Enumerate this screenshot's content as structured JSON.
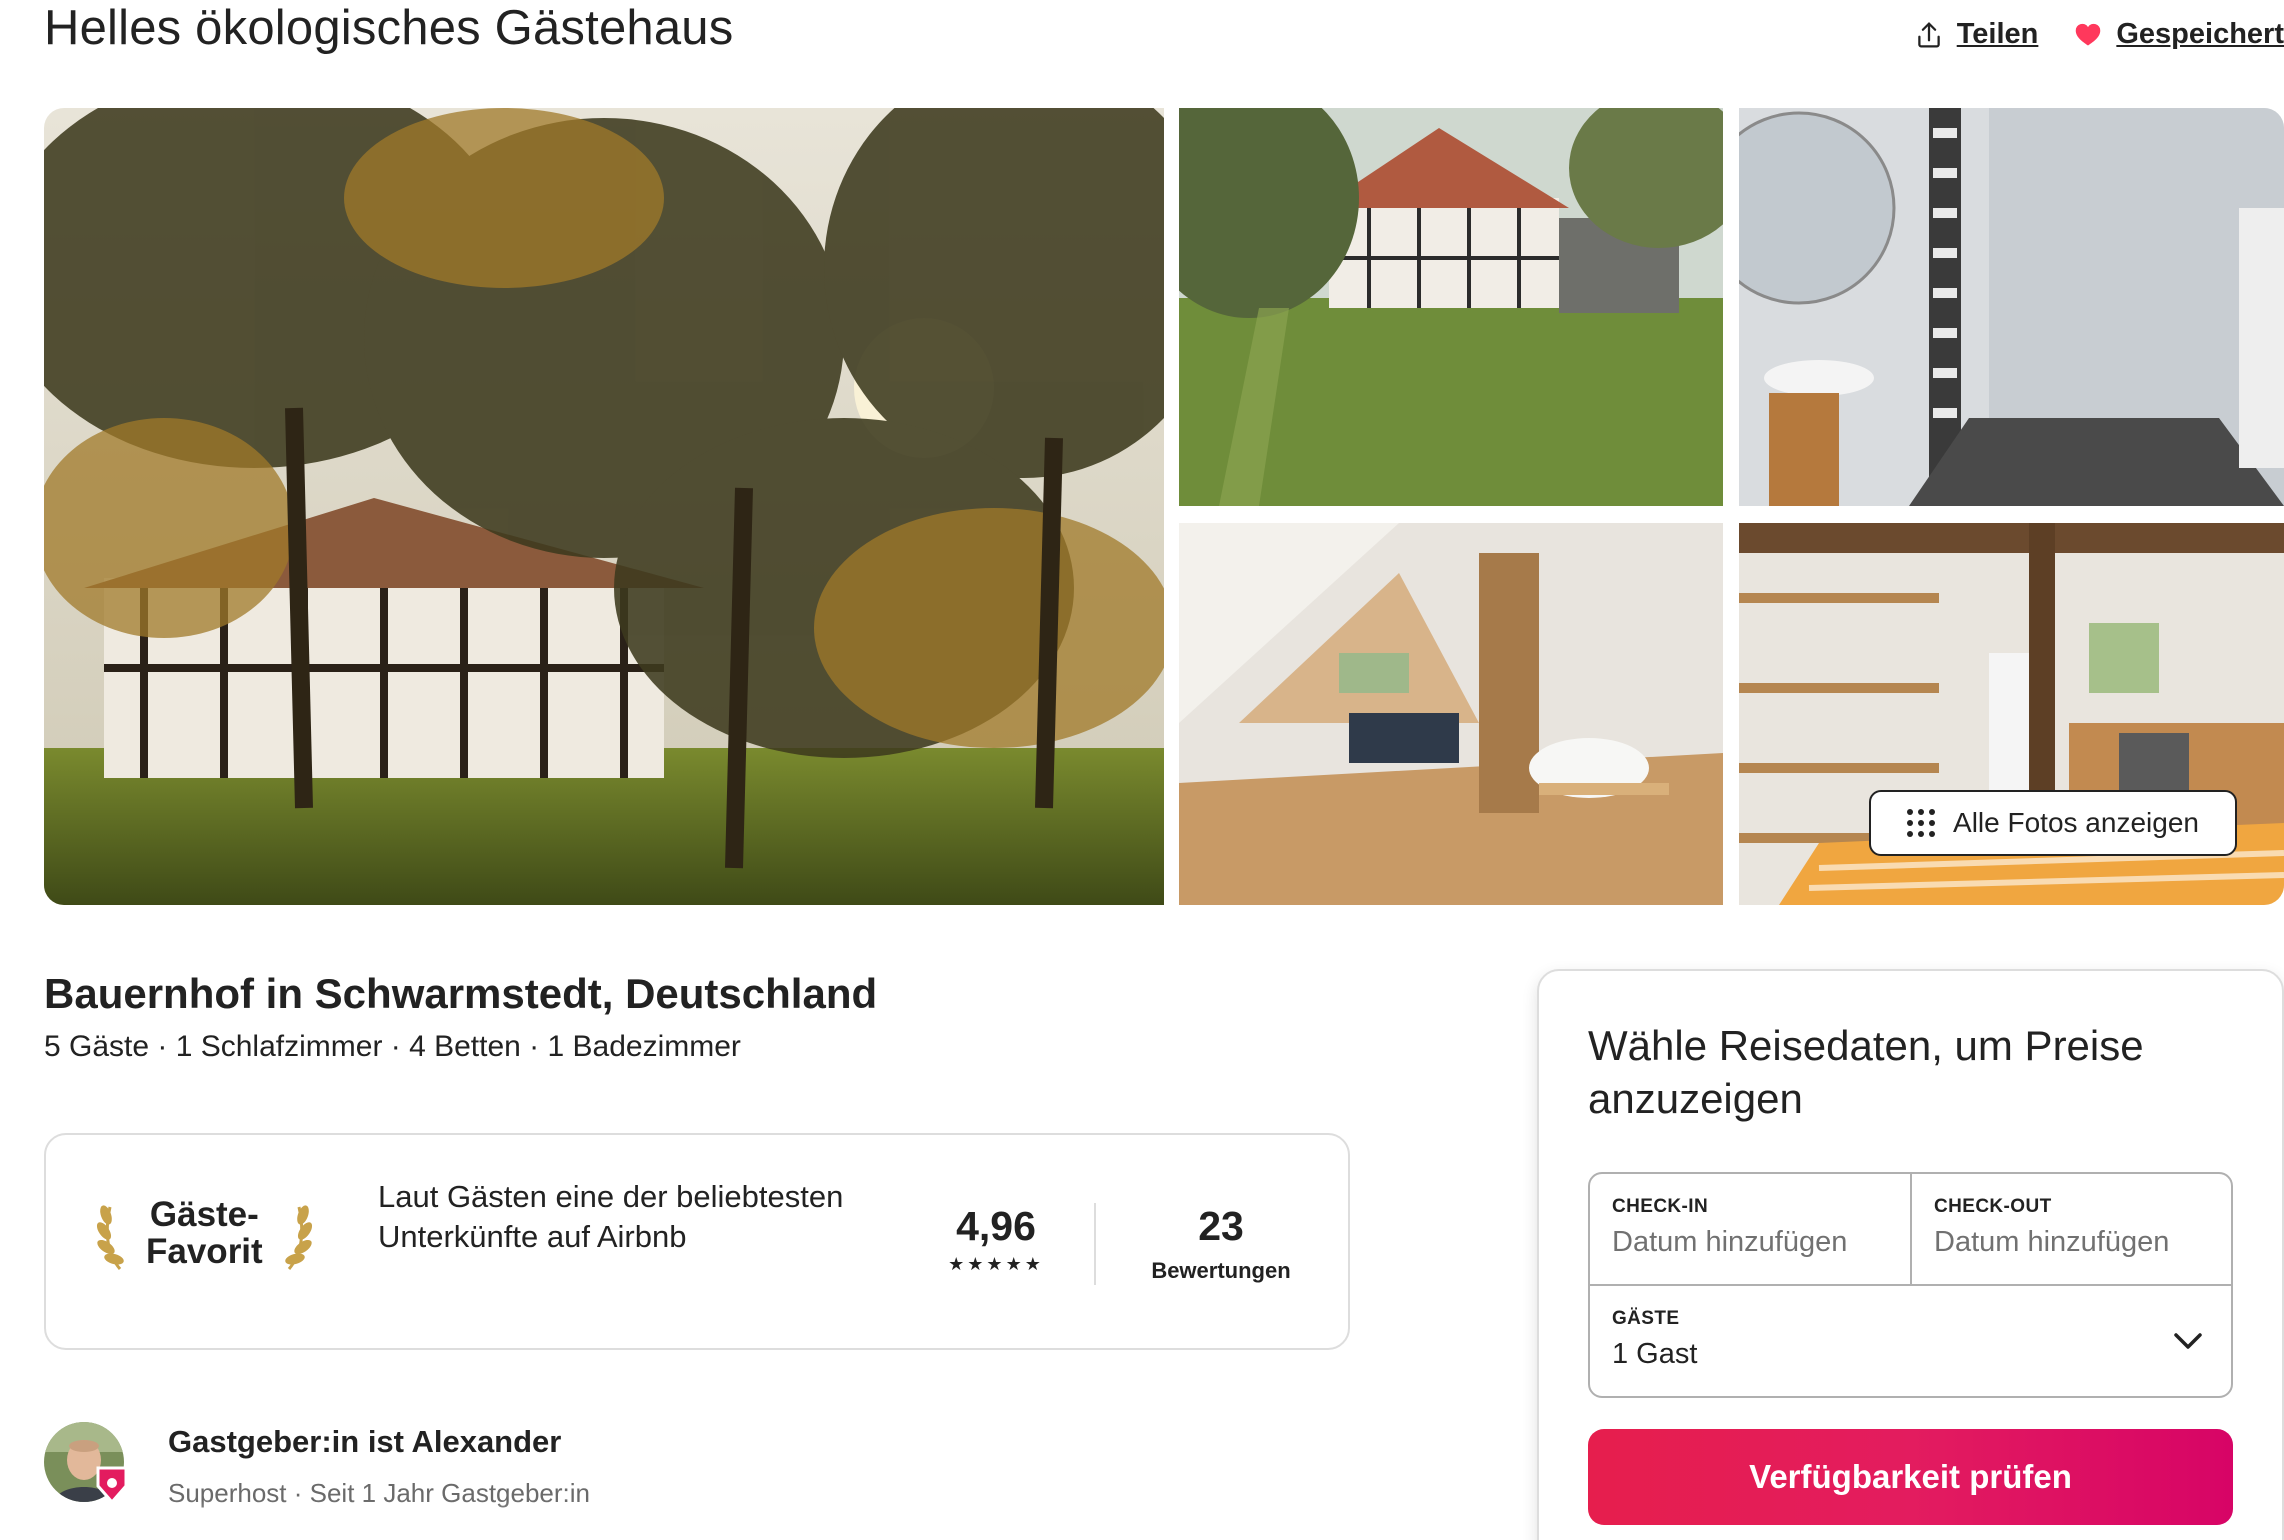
{
  "listing": {
    "title": "Helles ökologisches Gästehaus",
    "subtitle": "Bauernhof in Schwarmstedt, Deutschland",
    "details": "5 Gäste · 1 Schlafzimmer · 4 Betten · 1 Badezimmer"
  },
  "actions": {
    "share_label": "Teilen",
    "saved_label": "Gespeichert",
    "show_all_photos": "Alle Fotos anzeigen"
  },
  "favorite": {
    "badge_line1": "Gäste-",
    "badge_line2": "Favorit",
    "description": "Laut Gästen eine der beliebtesten Unterkünfte auf Airbnb",
    "rating": "4,96",
    "stars": "★★★★★",
    "review_count": "23",
    "review_label": "Bewertungen"
  },
  "host": {
    "name": "Gastgeber:in ist Alexander",
    "subtitle": "Superhost · Seit 1 Jahr Gastgeber:in"
  },
  "booking": {
    "title": "Wähle Reisedaten, um Preise anzuzeigen",
    "checkin_label": "CHECK-IN",
    "checkin_value": "Datum hinzufügen",
    "checkout_label": "CHECK-OUT",
    "checkout_value": "Datum hinzufügen",
    "guests_label": "GÄSTE",
    "guests_value": "1 Gast",
    "button_label": "Verfügbarkeit prüfen"
  },
  "colors": {
    "brand": "#e31c5f",
    "heart": "#ff385c",
    "text": "#222222",
    "muted": "#717171",
    "border": "#dddddd"
  },
  "icons": [
    "share-icon",
    "heart-icon",
    "grid-dots-icon",
    "laurel-left-icon",
    "laurel-right-icon",
    "chevron-down-icon",
    "superhost-badge-icon"
  ]
}
